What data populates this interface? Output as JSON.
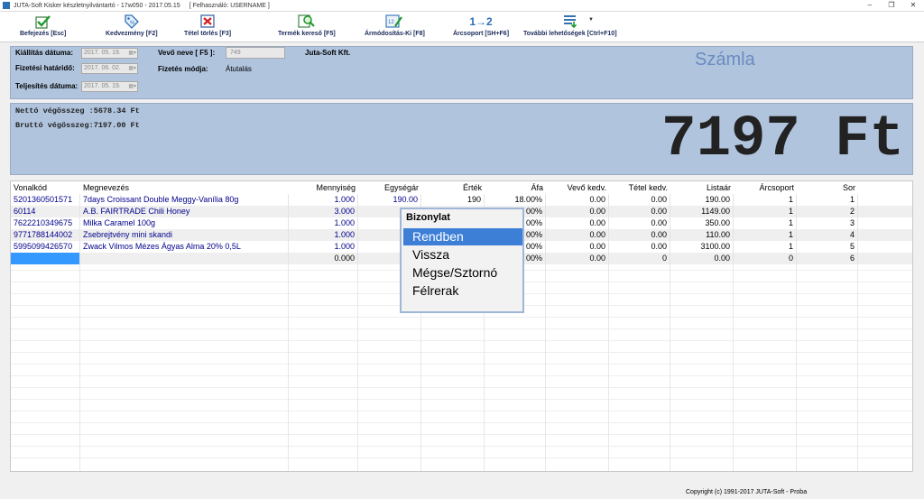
{
  "window": {
    "title": "JUTA-Soft Kisker készletnyilvántartó - 17w050 - 2017.05.15",
    "user_text": "[ Felhasználó:   USERNAME ]",
    "controls": [
      "–",
      "❐",
      "✕"
    ]
  },
  "toolbar": {
    "buttons": [
      {
        "label": "Befejezés [Esc]",
        "icon": "check-icon"
      },
      {
        "label": "Kedvezmény [F2]",
        "icon": "discount-tag-icon"
      },
      {
        "label": "Tétel törlés [F3]",
        "icon": "delete-item-icon"
      },
      {
        "label": "Termék kereső [F5]",
        "icon": "product-search-icon"
      },
      {
        "label": "Ármódosítás-Ki [F8]",
        "icon": "price-edit-icon"
      },
      {
        "label": "Árcsoport [SH+F6]",
        "icon": "price-group-icon",
        "icon_text": "1→2"
      },
      {
        "label": "További lehetőségek [Ctrl+F10]",
        "icon": "more-options-icon"
      }
    ],
    "dropdown_glyph": "▼"
  },
  "header": {
    "issue_date_label": "Kiállítás dátuma:",
    "issue_date": "2017. 05. 19.",
    "due_date_label": "Fizetési határidő:",
    "due_date": "2017. 06. 02.",
    "fulfil_date_label": "Teljesítés dátuma:",
    "fulfil_date": "2017. 05. 19.",
    "customer_label": "Vevő neve [ F5 ]:",
    "customer_code": "749",
    "customer_name": "Juta-Soft Kft.",
    "payment_label": "Fizetés módja:",
    "payment_value": "Átutalás",
    "document_type": "Számla",
    "calendar_glyph": "▦▾"
  },
  "totals": {
    "net_line": "Nettó végösszeg :5678.34 Ft",
    "gross_line": "Bruttó végösszeg:7197.00 Ft",
    "big_total": "7197 Ft"
  },
  "table": {
    "columns": [
      "Vonalkód",
      "Megnevezés",
      "Mennyiség",
      "Egységár",
      "Érték",
      "Áfa",
      "Vevő kedv.",
      "Tétel kedv.",
      "Listaár",
      "Árcsoport",
      "Sor"
    ],
    "rows": [
      [
        "5201360501571",
        "7days Croissant Double Meggy-Vanília 80g",
        "1.000",
        "190.00",
        "190",
        "18.00%",
        "0.00",
        "0.00",
        "190.00",
        "1",
        "1"
      ],
      [
        "60114",
        "A.B. FAIRTRADE Chili Honey",
        "3.000",
        "114",
        "",
        "00%",
        "0.00",
        "0.00",
        "1149.00",
        "1",
        "2"
      ],
      [
        "7622210349675",
        "Milka Caramel 100g",
        "1.000",
        "35",
        "",
        "00%",
        "0.00",
        "0.00",
        "350.00",
        "1",
        "3"
      ],
      [
        "9771788144002",
        "Zsebrejtvény mini skandi",
        "1.000",
        "1",
        "",
        "00%",
        "0.00",
        "0.00",
        "110.00",
        "1",
        "4"
      ],
      [
        "5995099426570",
        "Zwack Vilmos Mézes Ágyas Alma 20% 0,5L",
        "1.000",
        "310",
        "",
        "00%",
        "0.00",
        "0.00",
        "3100.00",
        "1",
        "5"
      ],
      [
        "",
        "",
        "0.000",
        "0.00",
        "",
        "00%",
        "0.00",
        "0",
        "0.00",
        "0",
        "6"
      ]
    ]
  },
  "popup": {
    "title": "Bizonylat",
    "items": [
      "Rendben",
      "Vissza",
      "Mégse/Sztornó",
      "Félrerak"
    ],
    "selected_index": 0
  },
  "status": {
    "copyright": "Copyright (c) 1991-2017 JUTA-Soft  -  Proba"
  }
}
